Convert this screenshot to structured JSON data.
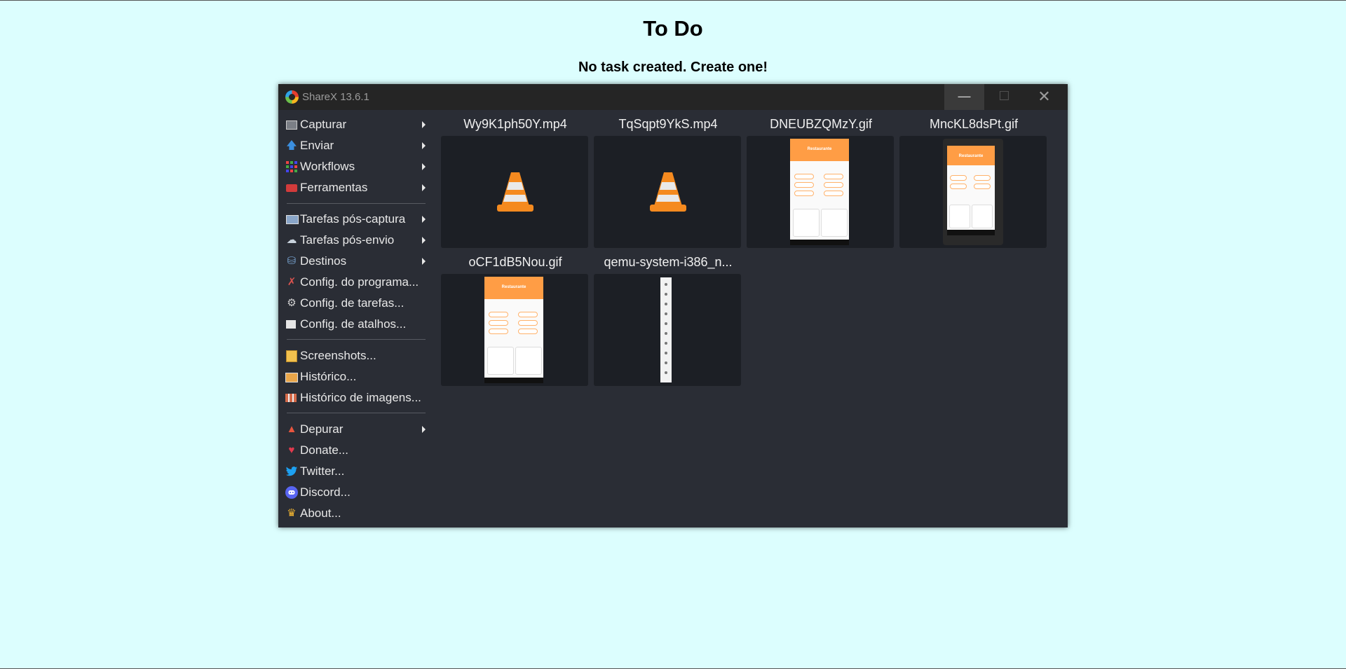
{
  "page": {
    "title": "To Do",
    "subtitle": "No task created. Create one!"
  },
  "window": {
    "title": "ShareX 13.6.1",
    "minimize_glyph": "—",
    "maximize_glyph": "☐",
    "close_glyph": "✕"
  },
  "menu": {
    "items": [
      {
        "label": "Capturar",
        "icon": "capture-icon",
        "submenu": true
      },
      {
        "label": "Enviar",
        "icon": "upload-arrow-icon",
        "submenu": true
      },
      {
        "label": "Workflows",
        "icon": "workflows-grid-icon",
        "submenu": true
      },
      {
        "label": "Ferramentas",
        "icon": "toolbox-icon",
        "submenu": true
      },
      {
        "label": "Tarefas pós-captura",
        "icon": "after-capture-icon",
        "submenu": true
      },
      {
        "label": "Tarefas pós-envio",
        "icon": "after-upload-icon",
        "submenu": true
      },
      {
        "label": "Destinos",
        "icon": "destinations-icon",
        "submenu": true
      },
      {
        "label": "Config. do programa...",
        "icon": "wrench-icon",
        "submenu": false
      },
      {
        "label": "Config. de tarefas...",
        "icon": "gear-icon",
        "submenu": false
      },
      {
        "label": "Config. de atalhos...",
        "icon": "keyboard-icon",
        "submenu": false
      },
      {
        "label": "Screenshots...",
        "icon": "folder-icon",
        "submenu": false
      },
      {
        "label": "Histórico...",
        "icon": "history-icon",
        "submenu": false
      },
      {
        "label": "Histórico de imagens...",
        "icon": "image-history-icon",
        "submenu": false
      },
      {
        "label": "Depurar",
        "icon": "debug-cone-icon",
        "submenu": true
      },
      {
        "label": "Donate...",
        "icon": "heart-icon",
        "submenu": false
      },
      {
        "label": "Twitter...",
        "icon": "twitter-icon",
        "submenu": false
      },
      {
        "label": "Discord...",
        "icon": "discord-icon",
        "submenu": false
      },
      {
        "label": "About...",
        "icon": "crown-icon",
        "submenu": false
      }
    ]
  },
  "files": [
    {
      "name": "Wy9K1ph50Y.mp4",
      "preview": "vlc-cone-icon"
    },
    {
      "name": "TqSqpt9YkS.mp4",
      "preview": "vlc-cone-icon"
    },
    {
      "name": "DNEUBZQMzY.gif",
      "preview": "phone-screenshot",
      "app_title": "Restaurante"
    },
    {
      "name": "MncKL8dsPt.gif",
      "preview": "phone-screenshot",
      "app_title": "Restaurante"
    },
    {
      "name": "oCF1dB5Nou.gif",
      "preview": "phone-screenshot",
      "app_title": "Restaurante"
    },
    {
      "name": "qemu-system-i386_n...",
      "preview": "emulator-toolbar"
    }
  ],
  "colors": {
    "page_bg": "#dcfefe",
    "window_bg": "#2a2d35",
    "titlebar_bg": "#252525",
    "thumb_bg": "#1c1f25",
    "accent_orange": "#ff9d45"
  }
}
